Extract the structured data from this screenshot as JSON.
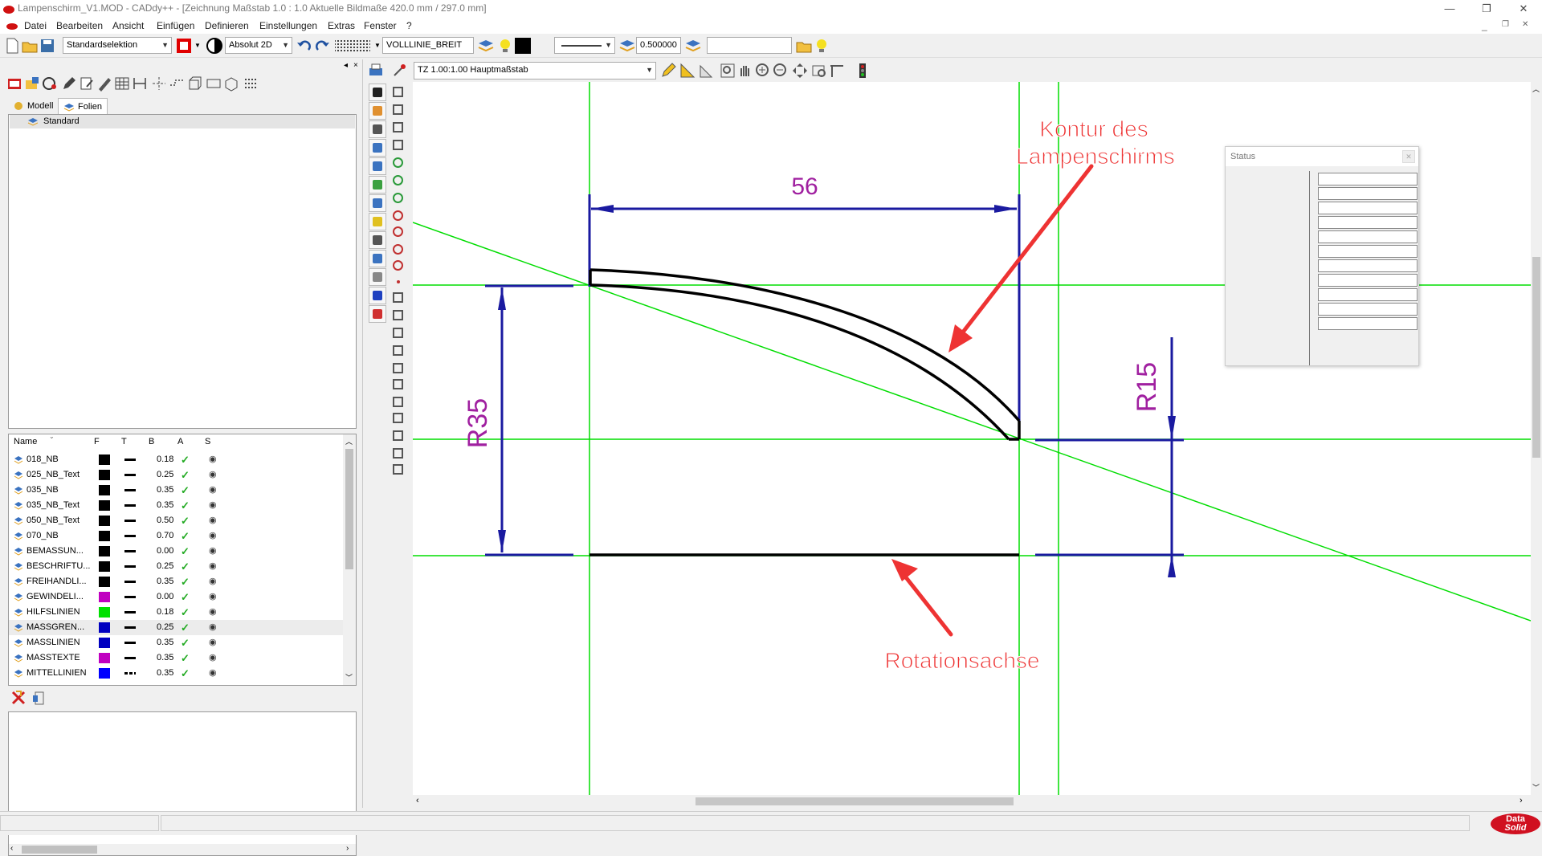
{
  "window": {
    "title": "Lampenschirm_V1.MOD  -  CADdy++ - [Zeichnung   Maßstab 1.0 : 1.0   Aktuelle Bildmaße 420.0 mm / 297.0 mm]",
    "minimize": "—",
    "restore": "❐",
    "close": "✕",
    "child_min": "_",
    "child_restore": "❐",
    "child_close": "✕"
  },
  "menu": [
    "Datei",
    "Bearbeiten",
    "Ansicht",
    "Einfügen",
    "Definieren",
    "Einstellungen",
    "Extras",
    "Fenster",
    "?"
  ],
  "toolbar": {
    "selection_mode": "Standardselektion",
    "coord_mode": "Absolut 2D",
    "line_type": "VOLLLINIE_BREIT",
    "line_width": "0.500000",
    "search_value": ""
  },
  "canvas_toolbar": {
    "scale": "TZ 1.00:1.00 Hauptmaßstab"
  },
  "left_panel": {
    "tabs": [
      "Modell",
      "Folien"
    ],
    "tree_root": "Standard",
    "layer_columns": [
      "Name",
      "F",
      "T",
      "B",
      "A",
      "S"
    ],
    "layers": [
      {
        "name": "018_NB",
        "color": "#000000",
        "width": "0.18",
        "icon": "layer-icon"
      },
      {
        "name": "025_NB_Text",
        "color": "#000000",
        "width": "0.25",
        "icon": "layer-icon"
      },
      {
        "name": "035_NB",
        "color": "#000000",
        "width": "0.35",
        "icon": "layer-icon"
      },
      {
        "name": "035_NB_Text",
        "color": "#000000",
        "width": "0.35",
        "icon": "layer-icon"
      },
      {
        "name": "050_NB_Text",
        "color": "#000000",
        "width": "0.50",
        "icon": "layer-icon"
      },
      {
        "name": "070_NB",
        "color": "#000000",
        "width": "0.70",
        "icon": "layer-icon"
      },
      {
        "name": "BEMASSUN...",
        "color": "#000000",
        "width": "0.00",
        "icon": "dimension-icon"
      },
      {
        "name": "BESCHRIFTU...",
        "color": "#000000",
        "width": "0.25",
        "icon": "text-icon"
      },
      {
        "name": "FREIHANDLI...",
        "color": "#000000",
        "width": "0.35",
        "icon": "layer-icon"
      },
      {
        "name": "GEWINDELI...",
        "color": "#c000c0",
        "width": "0.00",
        "icon": "thread-icon"
      },
      {
        "name": "HILFSLINIEN",
        "color": "#00e000",
        "width": "0.18",
        "icon": "helpline-icon"
      },
      {
        "name": "MASSGREN...",
        "color": "#0000c0",
        "width": "0.25",
        "icon": "dimension-limit-icon"
      },
      {
        "name": "MASSLINIEN",
        "color": "#0000c0",
        "width": "0.35",
        "icon": "dimension-line-icon"
      },
      {
        "name": "MASSTEXTE",
        "color": "#c000c0",
        "width": "0.35",
        "icon": "dimension-text-icon"
      },
      {
        "name": "MITTELLINIEN",
        "color": "#0000ff",
        "width": "0.35",
        "icon": "centerline-icon"
      }
    ]
  },
  "status_window": {
    "title": "Status",
    "close": "✕"
  },
  "drawing": {
    "dim_horizontal": "56",
    "dim_r35": "R35",
    "dim_r15": "R15",
    "annotation_contour_line1": "Kontur des",
    "annotation_contour_line2": "Lampenschirms",
    "annotation_axis": "Rotationsachse",
    "colors": {
      "helpline": "#00dd00",
      "dimension": "#1a1aa0",
      "dim_text": "#a020a0",
      "contour": "#000000",
      "annotation": "#ee3333"
    }
  },
  "brand": {
    "line1": "Data",
    "line2": "Solid"
  }
}
